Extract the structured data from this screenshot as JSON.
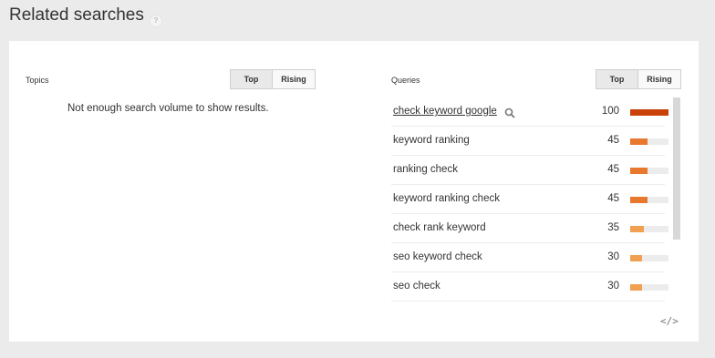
{
  "header": {
    "title": "Related searches",
    "help_icon": "?"
  },
  "topics": {
    "label": "Topics",
    "toggle": {
      "top": "Top",
      "rising": "Rising"
    },
    "empty_message": "Not enough search volume to show results."
  },
  "queries": {
    "label": "Queries",
    "toggle": {
      "top": "Top",
      "rising": "Rising"
    },
    "rows": [
      {
        "query": "check keyword google",
        "value": "100",
        "level": 1.0,
        "color": "#c94109"
      },
      {
        "query": "keyword ranking",
        "value": "45",
        "level": 0.45,
        "color": "#e8782e"
      },
      {
        "query": "ranking check",
        "value": "45",
        "level": 0.45,
        "color": "#e8782e"
      },
      {
        "query": "keyword ranking check",
        "value": "45",
        "level": 0.45,
        "color": "#e8782e"
      },
      {
        "query": "check rank keyword",
        "value": "35",
        "level": 0.35,
        "color": "#f0a050"
      },
      {
        "query": "seo keyword check",
        "value": "30",
        "level": 0.3,
        "color": "#f0a050"
      },
      {
        "query": "seo check",
        "value": "30",
        "level": 0.3,
        "color": "#f0a050"
      }
    ]
  },
  "footer": {
    "embed_icon": "</>"
  },
  "icons": {
    "search": "search-icon",
    "help": "help-icon",
    "embed": "embed-code-icon"
  }
}
